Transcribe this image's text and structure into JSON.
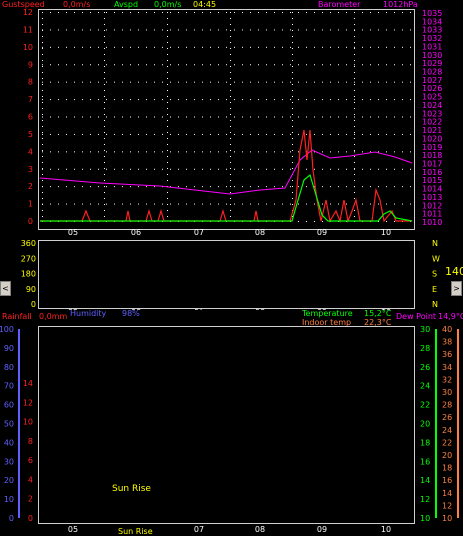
{
  "header": {
    "gust_label": "Gustspeed",
    "gust_value": "0,0m/s",
    "avspd_label": "Avspd",
    "avspd_value": "0,0m/s",
    "time": "04:45",
    "baro_label": "Barometer",
    "baro_value": "1012hPa"
  },
  "colors": {
    "gust": "#ff2020",
    "avspd": "#00ff00",
    "baro": "#ff00ff",
    "wind_dir": "#ffff00",
    "humidity": "#6060ff",
    "rain": "#ff2020",
    "temperature": "#00ff00",
    "indoor_temp": "#ff8040",
    "dew_point": "#ff00ff",
    "grid": "#ffffff"
  },
  "days": [
    "05",
    "06",
    "07",
    "08",
    "09",
    "10"
  ],
  "panel1": {
    "y_left_ticks": [
      "12",
      "11",
      "10",
      "9",
      "8",
      "7",
      "6",
      "5",
      "4",
      "3",
      "2",
      "1",
      "0"
    ],
    "y_right_ticks": [
      "1035",
      "1034",
      "1033",
      "1032",
      "1031",
      "1030",
      "1029",
      "1028",
      "1027",
      "1026",
      "1025",
      "1024",
      "1023",
      "1022",
      "1021",
      "1020",
      "1019",
      "1018",
      "1017",
      "1016",
      "1015",
      "1014",
      "1013",
      "1012",
      "1011",
      "1010"
    ]
  },
  "panel2": {
    "y_ticks": [
      "360",
      "270",
      "180",
      "90",
      "0"
    ],
    "dir_labels": [
      "N",
      "W",
      "S",
      "E",
      "N"
    ],
    "wind_dir_value": "140°",
    "scroll_left": "<",
    "scroll_right": ">"
  },
  "panel3": {
    "rain_label": "Rainfall",
    "rain_value": "0,0mm",
    "humidity_label": "Humidity",
    "humidity_value": "98%",
    "temp_label": "Temperature",
    "temp_value": "15,2°C",
    "indoor_label": "Indoor temp",
    "indoor_value": "22,3°C",
    "dew_label": "Dew Point",
    "dew_value": "14,9°C",
    "y_left_ticks": [
      "100",
      "90",
      "80",
      "70",
      "60",
      "50",
      "40",
      "30",
      "20",
      "10",
      "0"
    ],
    "y_left2_ticks": [
      "14",
      "12",
      "10",
      "8",
      "6",
      "4",
      "2",
      "0"
    ],
    "y_right1_ticks": [
      "30",
      "28",
      "26",
      "24",
      "22",
      "20",
      "18",
      "16",
      "14",
      "12",
      "10"
    ],
    "y_right2_ticks": [
      "40",
      "38",
      "36",
      "34",
      "32",
      "30",
      "28",
      "26",
      "24",
      "22",
      "20",
      "18",
      "16",
      "14",
      "12",
      "10"
    ],
    "sunrise_label": "Sun Rise",
    "sunrise_axis_label": "Sun Rise"
  }
}
